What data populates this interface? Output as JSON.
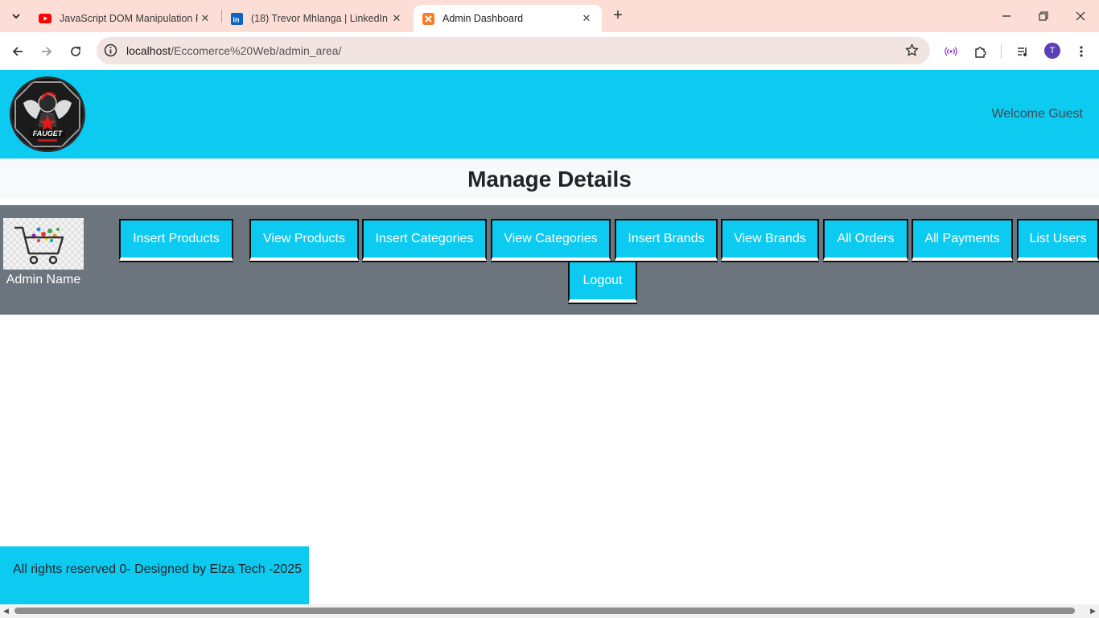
{
  "browser": {
    "tabs": [
      {
        "title": "JavaScript DOM Manipulation F",
        "icon": "youtube-icon"
      },
      {
        "title": "(18) Trevor Mhlanga | LinkedIn",
        "icon": "linkedin-icon"
      },
      {
        "title": "Admin Dashboard",
        "icon": "xampp-icon",
        "active": true
      }
    ],
    "url_host": "localhost",
    "url_path": "/Eccomerce%20Web/admin_area/",
    "profile_initial": "T"
  },
  "header": {
    "logo_text": "FAUGET",
    "welcome": "Welcome Guest"
  },
  "manage": {
    "title": "Manage Details"
  },
  "admin": {
    "name": "Admin Name",
    "buttons": [
      "Insert Products",
      "View Products",
      "Insert Categories",
      "View Categories",
      "Insert Brands",
      "View Brands",
      "All Orders",
      "All Payments",
      "List Users",
      "Logout"
    ]
  },
  "footer": {
    "text": "All rights reserved 0- Designed by Elza Tech -2025"
  },
  "colors": {
    "accent": "#0dcaf0",
    "panel": "#6c757d",
    "tabstrip": "#fcded6"
  }
}
